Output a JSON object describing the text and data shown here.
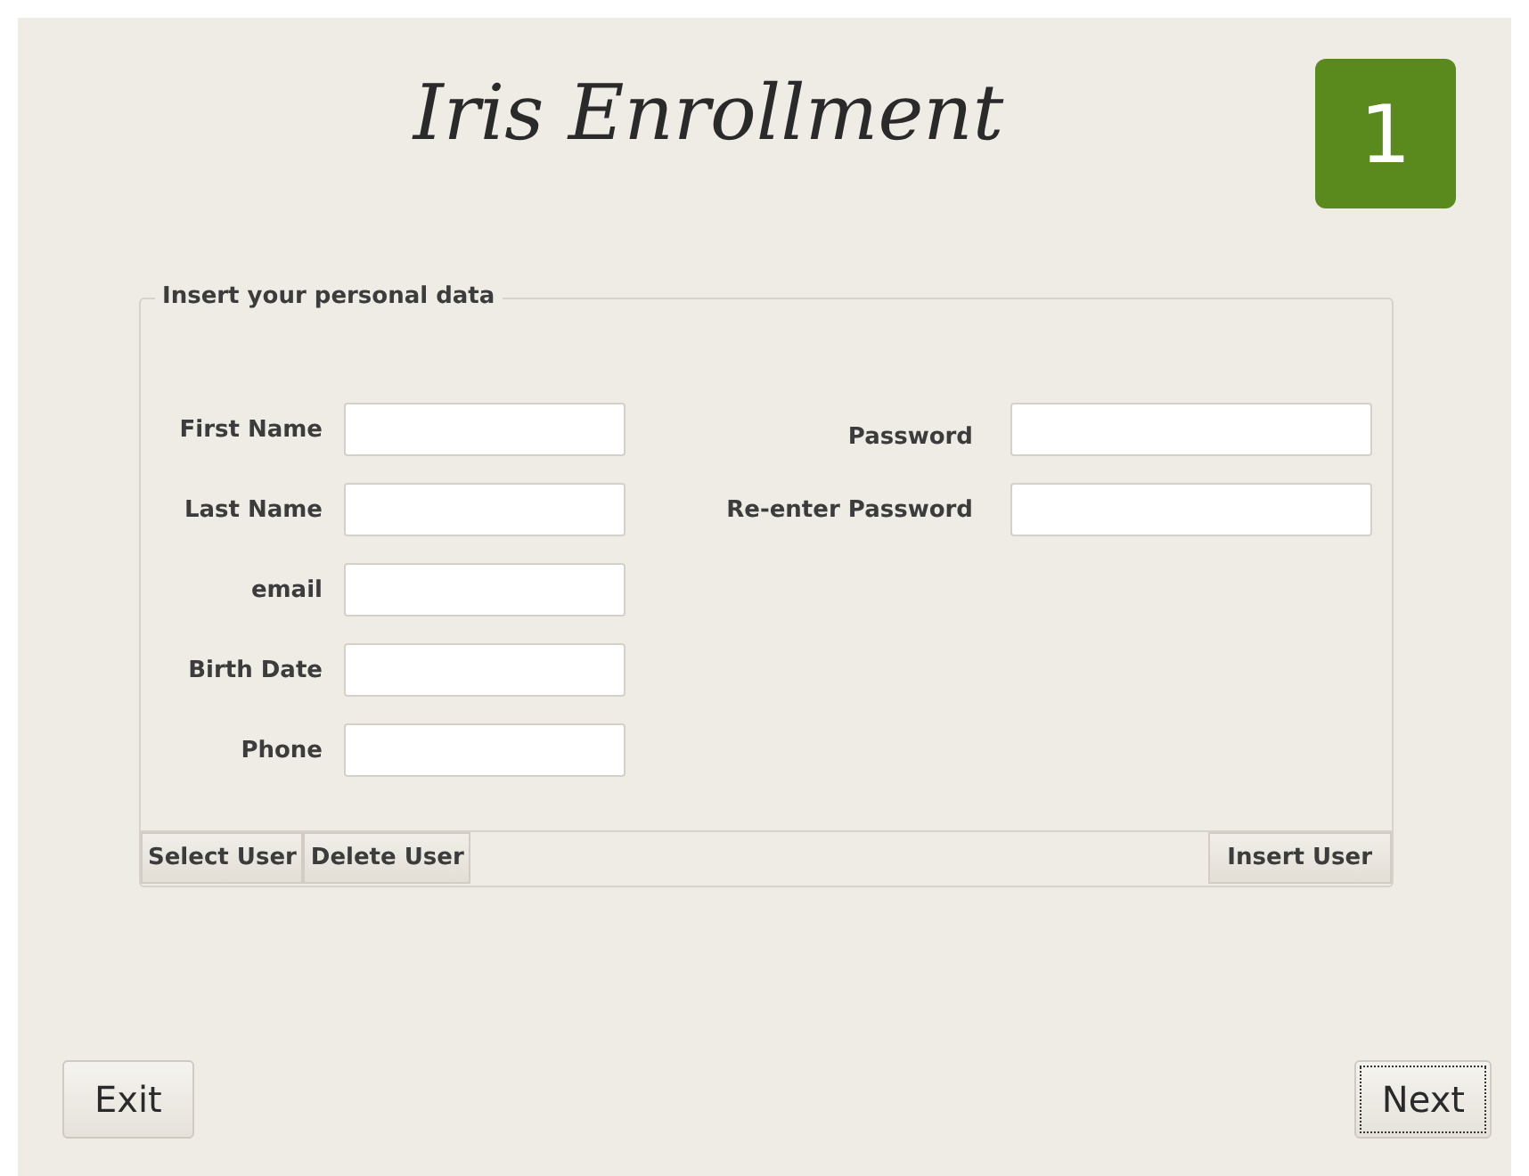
{
  "title": "Iris Enrollment",
  "step": "1",
  "group": {
    "legend": "Insert your personal data",
    "left_fields": [
      {
        "label": "First Name"
      },
      {
        "label": "Last Name"
      },
      {
        "label": "email"
      },
      {
        "label": "Birth Date"
      },
      {
        "label": "Phone"
      }
    ],
    "right_fields": [
      {
        "label": "Password"
      },
      {
        "label": "Re-enter Password"
      }
    ],
    "toolbar_left": [
      "Select User",
      "Delete User"
    ],
    "toolbar_right": [
      "Insert User"
    ]
  },
  "buttons": [
    {
      "label": "Exit",
      "focused": false
    },
    {
      "label": "Next",
      "focused": true
    }
  ]
}
